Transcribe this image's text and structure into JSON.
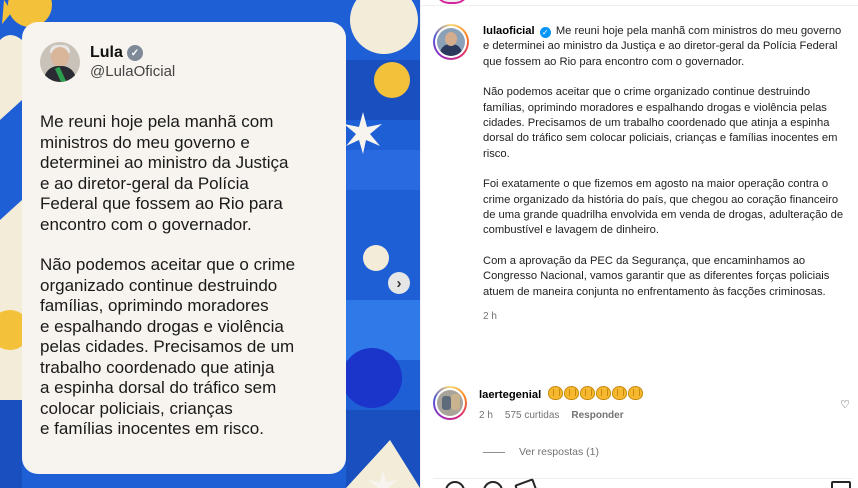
{
  "card": {
    "name": "Lula",
    "handle": "@LulaOficial",
    "paragraph1": "Me reuni hoje pela manhã com\nministros do meu governo e\ndeterminei ao ministro da Justiça\ne ao diretor-geral da Polícia\nFederal que fossem ao Rio para\nencontro com o governador.",
    "paragraph2": "Não podemos aceitar que o crime\norganizado continue destruindo\nfamílias, oprimindo moradores\ne espalhando drogas e violência\npelas cidades. Precisamos de um\ntrabalho coordenado que atinja\na espinha dorsal do tráfico sem\ncolocar policiais, crianças\ne famílias inocentes em risco."
  },
  "carousel": {
    "next_icon": "chevron-right-icon"
  },
  "post": {
    "username": "lulaoficial",
    "caption": [
      "Me reuni hoje pela manhã com ministros do meu governo e determinei ao ministro da Justiça e ao diretor-geral da Polícia Federal que fossem ao Rio para encontro com o governador.",
      "Não podemos aceitar que o crime organizado continue destruindo famílias, oprimindo moradores e espalhando drogas e violência pelas cidades. Precisamos de um trabalho coordenado que atinja a espinha dorsal do tráfico sem colocar policiais, crianças e famílias inocentes em risco.",
      "Foi exatamente o que fizemos em agosto na maior operação contra o crime organizado da história do país, que chegou ao coração financeiro de uma grande quadrilha envolvida em venda de drogas, adulteração de combustível e lavagem de dinheiro.",
      "Com a aprovação da PEC da Segurança, que encaminhamos ao Congresso Nacional, vamos garantir que as diferentes forças policiais atuem de maneira conjunta no enfrentamento às facções criminosas."
    ],
    "time": "2 h"
  },
  "comment": {
    "username": "laertegenial",
    "emoji": "clapping-hands x6",
    "time": "2 h",
    "likes": "575 curtidas",
    "reply_label": "Responder",
    "view_replies": "Ver respostas (1)"
  },
  "colors": {
    "background_blue": "#1f5fd6",
    "accent_yellow": "#f4c13a",
    "cream": "#f3ecd8",
    "card": "#f7f4ef",
    "verified_blue": "#0095f6"
  }
}
